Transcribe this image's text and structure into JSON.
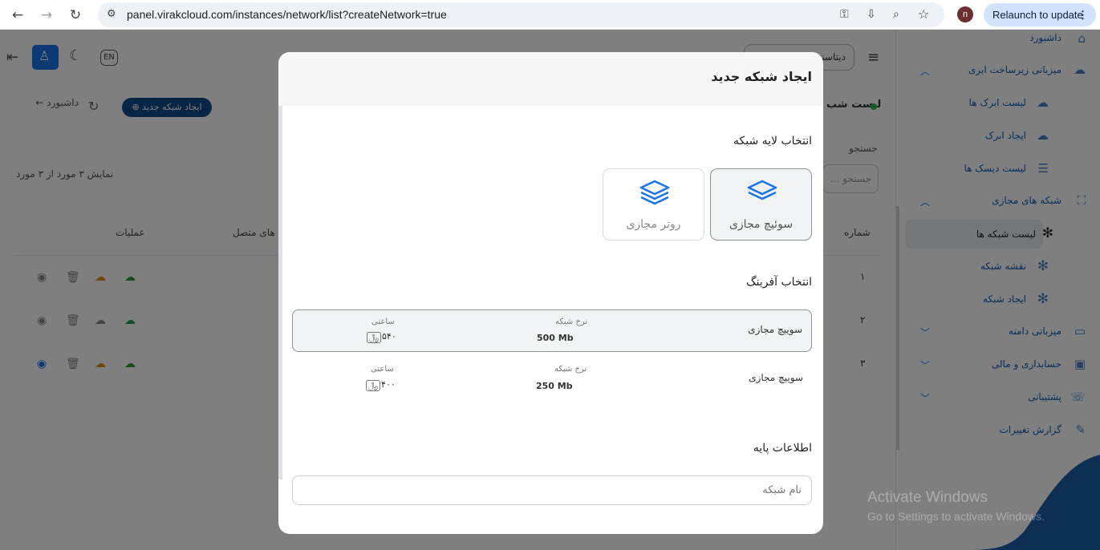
{
  "browser": {
    "url": "panel.virakcloud.com/instances/network/list?createNetwork=true",
    "relaunch_label": "Relaunch to update",
    "profile_initial": "n"
  },
  "sidebar": {
    "items": [
      {
        "label": "داشبورد",
        "icon": "dashboard-icon"
      },
      {
        "label": "میزبانی زیرساخت ابری",
        "icon": "cloud-icon"
      },
      {
        "label": "لیست ابرک ها",
        "icon": "cloud-list-icon"
      },
      {
        "label": "ایجاد ابرک",
        "icon": "cloud-add-icon"
      },
      {
        "label": "لیست دیسک ها",
        "icon": "disk-icon"
      },
      {
        "label": "شبکه های مجازی",
        "icon": "network-icon"
      },
      {
        "label": "لیست شبکه ها",
        "icon": "network-list-icon"
      },
      {
        "label": "نقشه شبکه",
        "icon": "network-map-icon"
      },
      {
        "label": "ایجاد شبکه",
        "icon": "network-add-icon"
      },
      {
        "label": "میزبانی دامنه",
        "icon": "domain-icon"
      },
      {
        "label": "حسابداری و مالی",
        "icon": "wallet-icon"
      },
      {
        "label": "پشتیبانی",
        "icon": "support-icon"
      },
      {
        "label": "گزارش تغییرات",
        "icon": "changelog-icon"
      }
    ]
  },
  "toolbar": {
    "en_label": "EN",
    "datacenter_label": "دیتاسنتر",
    "create_network_label": "ایجاد شبکه جدید",
    "breadcrumb_label": "داشبورد",
    "list_title": "لیست شب",
    "search_label": "جستجو",
    "search_placeholder": "جستجو ...",
    "showing_text": "نمایش ۳ مورد از ۳ مورد"
  },
  "table": {
    "headers": {
      "number": "شماره",
      "connected": "های متصل",
      "actions": "عملیات"
    },
    "rows": [
      "۱",
      "۲",
      "۳"
    ]
  },
  "modal": {
    "title": "ایجاد شبکه جدید",
    "layer_title": "انتخاب لایه شبکه",
    "layers": [
      {
        "label": "سوئیچ مجازی",
        "selected": true
      },
      {
        "label": "روتر مجازی",
        "selected": false
      }
    ],
    "offer_title": "انتخاب آفرینگ",
    "plans": [
      {
        "name": "سوییچ مجازی",
        "rate_label": "نرخ شبکه",
        "rate": "500 Mb",
        "price_label": "ساعتی",
        "price": "۵۴۰"
      },
      {
        "name": "سوییچ مجازی",
        "rate_label": "نرخ شبکه",
        "rate": "250 Mb",
        "price_label": "ساعتی",
        "price": "۴۰۰"
      }
    ],
    "base_info_title": "اطلاعات پایه",
    "name_placeholder": "نام شبکه"
  },
  "watermark": {
    "line1": "Activate Windows",
    "line2": "Go to Settings to activate Windows."
  },
  "colors": {
    "primary": "#0e4a8a",
    "link": "#0e5db3",
    "accent_icon": "#1a73e8"
  }
}
